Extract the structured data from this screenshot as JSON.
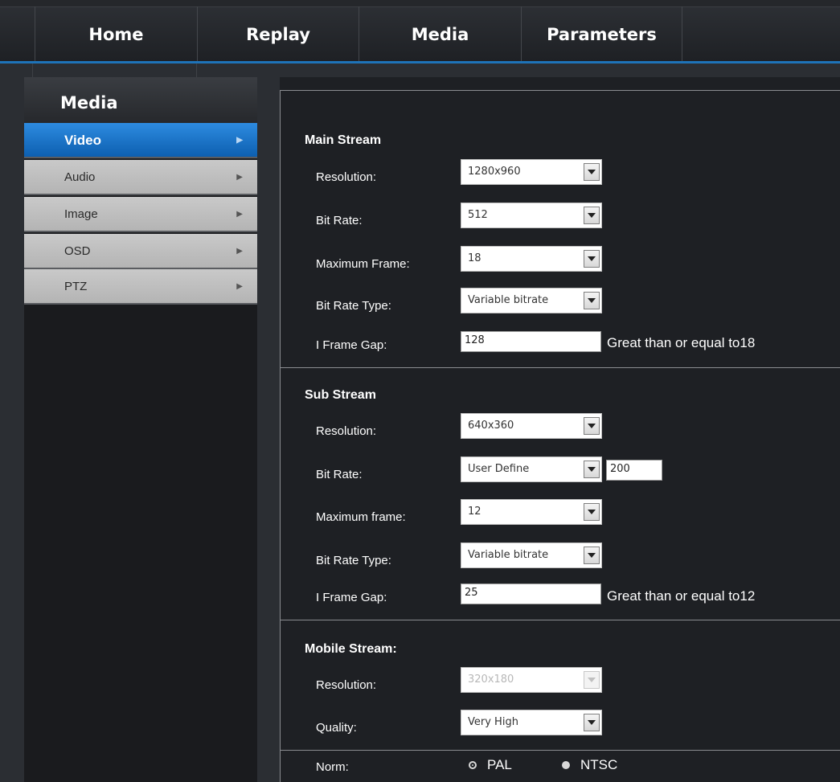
{
  "nav": {
    "tabs": [
      "Home",
      "Replay",
      "Media",
      "Parameters"
    ]
  },
  "sidebar": {
    "title": "Media",
    "items": [
      {
        "label": "Video",
        "active": true
      },
      {
        "label": "Audio"
      },
      {
        "label": "Image"
      },
      {
        "label": "OSD"
      },
      {
        "label": "PTZ"
      }
    ]
  },
  "main_stream": {
    "title": "Main Stream",
    "resolution_label": "Resolution:",
    "resolution": "1280x960",
    "bitrate_label": "Bit Rate:",
    "bitrate": "512",
    "max_frame_label": "Maximum Frame:",
    "max_frame": "18",
    "bitrate_type_label": "Bit Rate Type:",
    "bitrate_type": "Variable bitrate",
    "iframe_label": "I Frame Gap:",
    "iframe_gap": "128",
    "iframe_hint": "Great than or equal to18"
  },
  "sub_stream": {
    "title": "Sub Stream",
    "resolution_label": "Resolution:",
    "resolution": "640x360",
    "bitrate_label": "Bit Rate:",
    "bitrate": "User Define",
    "bitrate_custom": "200",
    "max_frame_label": "Maximum frame:",
    "max_frame": "12",
    "bitrate_type_label": "Bit Rate Type:",
    "bitrate_type": "Variable bitrate",
    "iframe_label": "I Frame Gap:",
    "iframe_gap": "25",
    "iframe_hint": "Great than or equal to12"
  },
  "mobile_stream": {
    "title": "Mobile Stream:",
    "resolution_label": "Resolution:",
    "resolution": "320x180",
    "quality_label": "Quality:",
    "quality": "Very High"
  },
  "norm": {
    "label": "Norm:",
    "options": [
      "PAL",
      "NTSC"
    ],
    "selected": "PAL"
  },
  "colors": {
    "accent": "#1e73b8",
    "active_item": "#1a78d0",
    "background": "#1e2024"
  }
}
